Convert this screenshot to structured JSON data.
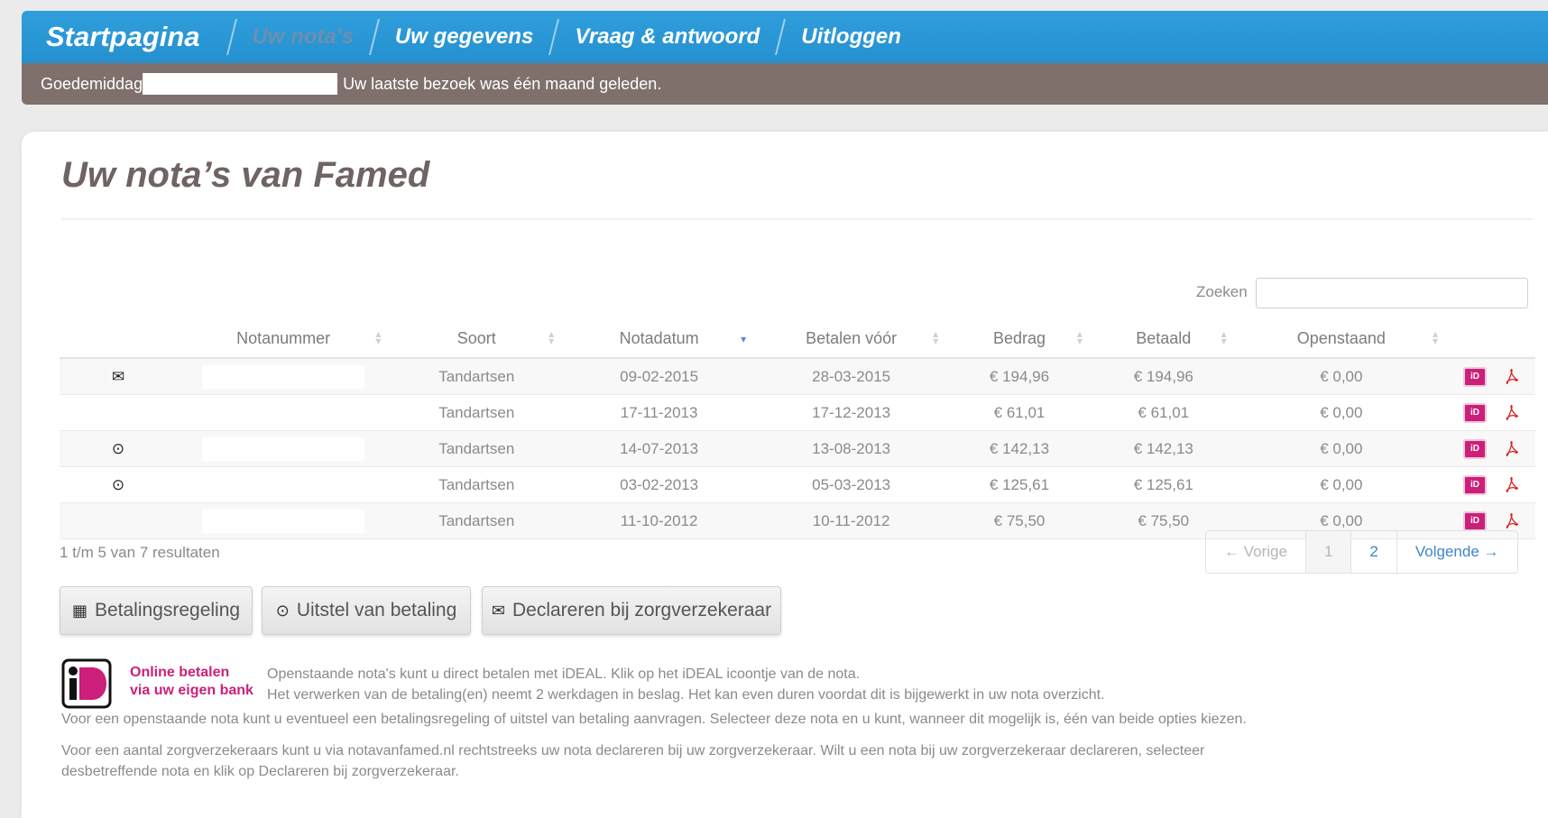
{
  "nav": {
    "home": "Startpagina",
    "items": [
      "Uw nota's",
      "Uw gegevens",
      "Vraag & antwoord",
      "Uitloggen"
    ]
  },
  "greeting": {
    "label": "Goedemiddag",
    "last_visit": "Uw laatste bezoek was één maand geleden."
  },
  "page": {
    "title": "Uw nota’s van Famed"
  },
  "search": {
    "label": "Zoeken",
    "value": ""
  },
  "table": {
    "headers": [
      "Notanummer",
      "Soort",
      "Notadatum",
      "Betalen vóór",
      "Bedrag",
      "Betaald",
      "Openstaand"
    ],
    "rows": [
      {
        "status_icon": "envelope-icon",
        "soort": "Tandartsen",
        "notadatum": "09-02-2015",
        "betalen_voor": "28-03-2015",
        "bedrag": "€ 194,96",
        "betaald": "€ 194,96",
        "openstaand": "€ 0,00"
      },
      {
        "status_icon": "",
        "soort": "Tandartsen",
        "notadatum": "17-11-2013",
        "betalen_voor": "17-12-2013",
        "bedrag": "€ 61,01",
        "betaald": "€ 61,01",
        "openstaand": "€ 0,00"
      },
      {
        "status_icon": "clock-icon",
        "soort": "Tandartsen",
        "notadatum": "14-07-2013",
        "betalen_voor": "13-08-2013",
        "bedrag": "€ 142,13",
        "betaald": "€ 142,13",
        "openstaand": "€ 0,00"
      },
      {
        "status_icon": "clock-icon",
        "soort": "Tandartsen",
        "notadatum": "03-02-2013",
        "betalen_voor": "05-03-2013",
        "bedrag": "€ 125,61",
        "betaald": "€ 125,61",
        "openstaand": "€ 0,00"
      },
      {
        "status_icon": "",
        "soort": "Tandartsen",
        "notadatum": "11-10-2012",
        "betalen_voor": "10-11-2012",
        "bedrag": "€ 75,50",
        "betaald": "€ 75,50",
        "openstaand": "€ 0,00"
      }
    ],
    "result_count": "1 t/m 5 van 7 resultaten"
  },
  "pagination": {
    "prev": "← Vorige",
    "pages": [
      "1",
      "2"
    ],
    "next": "Volgende →"
  },
  "buttons": {
    "betalingsregeling": "Betalingsregeling",
    "uitstel": "Uitstel van betaling",
    "declareren": "Declareren bij zorgverzekeraar"
  },
  "info": {
    "ideal_tag_line1": "Online betalen",
    "ideal_tag_line2": "via uw eigen bank",
    "line1": "Openstaande nota's kunt u direct betalen met iDEAL. Klik op het iDEAL icoontje van de nota.",
    "line2": "Het verwerken van de betaling(en) neemt 2 werkdagen in beslag. Het kan even duren voordat dit is bijgewerkt in uw nota overzicht.",
    "para1": "Voor een openstaande nota kunt u eventueel een betalingsregeling of uitstel van betaling aanvragen. Selecteer deze nota en u kunt, wanneer dit mogelijk is, één van beide opties kiezen.",
    "para2_line1": "Voor een aantal zorgverzekeraars kunt u via notavanfamed.nl rechtstreeks uw nota declareren bij uw zorgverzekeraar. Wilt u een nota bij uw zorgverzekeraar declareren, selecteer",
    "para2_line2": "desbetreffende nota en klik op Declareren bij zorgverzekeraar."
  },
  "icons": {
    "envelope": "✉",
    "clock": "⊙",
    "calendar": "▦",
    "ideal": "iD"
  },
  "colors": {
    "nav_bg": "#2f9fdc",
    "greet_bg": "#7f706c",
    "ideal_pink": "#cc1f7a",
    "link_blue": "#3f86c9",
    "title": "#6f6463"
  }
}
